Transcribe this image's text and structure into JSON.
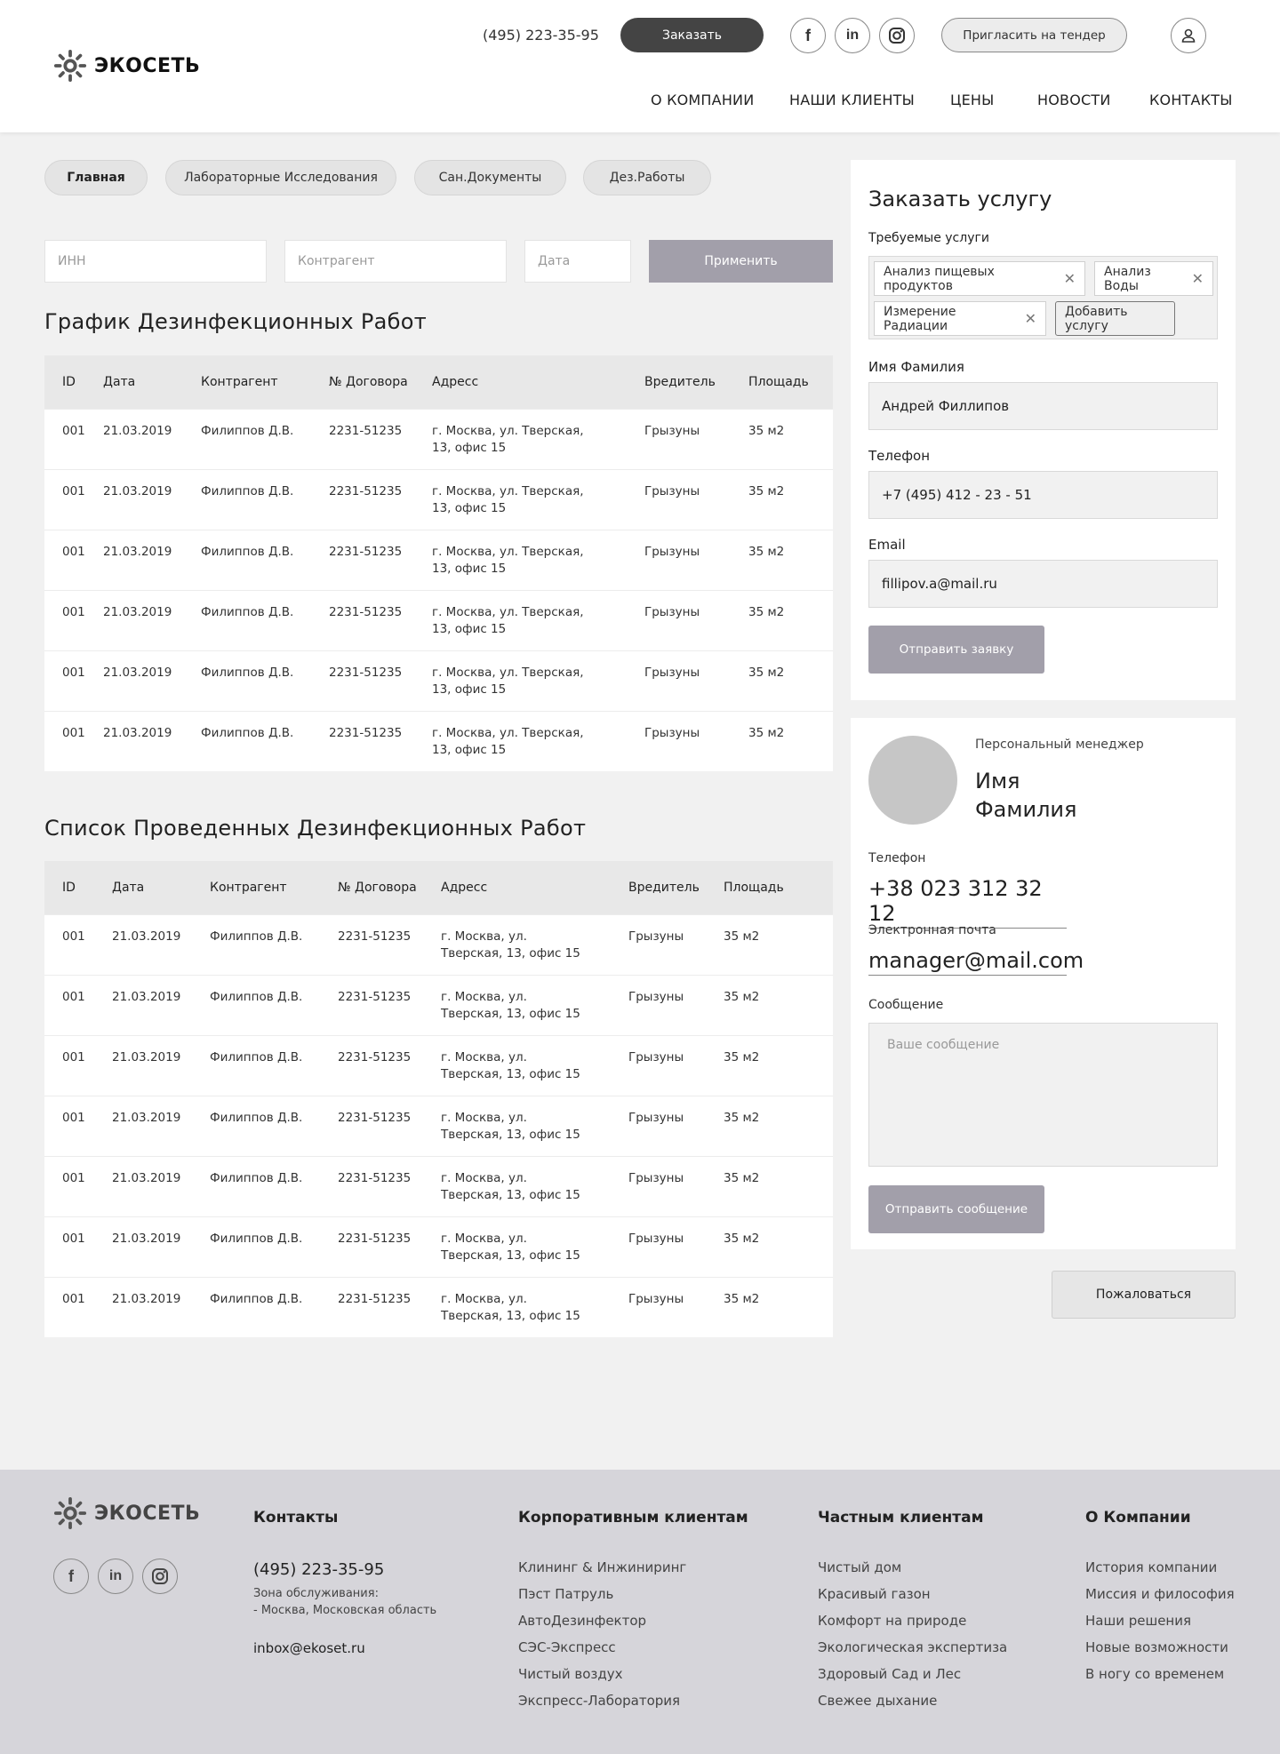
{
  "header": {
    "logo_text": "ЭКОСЕТЬ",
    "phone": "(495) 223-35-95",
    "order_button": "Заказать",
    "invite_button": "Пригласить на тендер",
    "social": [
      "facebook-icon",
      "linkedin-icon",
      "instagram-icon"
    ],
    "nav": [
      "О КОМПАНИИ",
      "НАШИ КЛИЕНТЫ",
      "ЦЕНЫ",
      "НОВОСТИ",
      "КОНТАКТЫ"
    ]
  },
  "tabs": [
    "Главная",
    "Лабораторные Исследования",
    "Сан.Документы",
    "Дез.Работы"
  ],
  "filters": {
    "inn_placeholder": "ИНН",
    "contractor_placeholder": "Контрагент",
    "date_placeholder": "Дата",
    "apply_button": "Применить"
  },
  "schedule": {
    "title": "График Дезинфекционных Работ",
    "columns": [
      "ID",
      "Дата",
      "Контрагент",
      "№ Договора",
      "Адресс",
      "Вредитель",
      "Площадь"
    ],
    "rows": [
      [
        "001",
        "21.03.2019",
        "Филиппов Д.В.",
        "2231-51235",
        "г. Москва, ул. Тверская, 13, офис 15",
        "Грызуны",
        "35 м2"
      ],
      [
        "001",
        "21.03.2019",
        "Филиппов Д.В.",
        "2231-51235",
        "г. Москва, ул. Тверская, 13, офис 15",
        "Грызуны",
        "35 м2"
      ],
      [
        "001",
        "21.03.2019",
        "Филиппов Д.В.",
        "2231-51235",
        "г. Москва, ул. Тверская, 13, офис 15",
        "Грызуны",
        "35 м2"
      ],
      [
        "001",
        "21.03.2019",
        "Филиппов Д.В.",
        "2231-51235",
        "г. Москва, ул. Тверская, 13, офис 15",
        "Грызуны",
        "35 м2"
      ],
      [
        "001",
        "21.03.2019",
        "Филиппов Д.В.",
        "2231-51235",
        "г. Москва, ул. Тверская, 13, офис 15",
        "Грызуны",
        "35 м2"
      ],
      [
        "001",
        "21.03.2019",
        "Филиппов Д.В.",
        "2231-51235",
        "г. Москва, ул. Тверская, 13, офис 15",
        "Грызуны",
        "35 м2"
      ]
    ]
  },
  "completed": {
    "title": "Список Проведенных Дезинфекционных Работ",
    "columns": [
      "ID",
      "Дата",
      "Контрагент",
      "№ Договора",
      "Адресс",
      "Вредитель",
      "Площадь"
    ],
    "rows": [
      [
        "001",
        "21.03.2019",
        "Филиппов Д.В.",
        "2231-51235",
        "г. Москва, ул. Тверская, 13, офис 15",
        "Грызуны",
        "35 м2"
      ],
      [
        "001",
        "21.03.2019",
        "Филиппов Д.В.",
        "2231-51235",
        "г. Москва, ул. Тверская, 13, офис 15",
        "Грызуны",
        "35 м2"
      ],
      [
        "001",
        "21.03.2019",
        "Филиппов Д.В.",
        "2231-51235",
        "г. Москва, ул. Тверская, 13, офис 15",
        "Грызуны",
        "35 м2"
      ],
      [
        "001",
        "21.03.2019",
        "Филиппов Д.В.",
        "2231-51235",
        "г. Москва, ул. Тверская, 13, офис 15",
        "Грызуны",
        "35 м2"
      ],
      [
        "001",
        "21.03.2019",
        "Филиппов Д.В.",
        "2231-51235",
        "г. Москва, ул. Тверская, 13, офис 15",
        "Грызуны",
        "35 м2"
      ],
      [
        "001",
        "21.03.2019",
        "Филиппов Д.В.",
        "2231-51235",
        "г. Москва, ул. Тверская, 13, офис 15",
        "Грызуны",
        "35 м2"
      ],
      [
        "001",
        "21.03.2019",
        "Филиппов Д.В.",
        "2231-51235",
        "г. Москва, ул. Тверская, 13, офис 15",
        "Грызуны",
        "35 м2"
      ]
    ]
  },
  "order_form": {
    "title": "Заказать услугу",
    "services_label": "Требуемые услуги",
    "services": [
      "Анализ пищевых продуктов",
      "Анализ Воды",
      "Измерение Радиации"
    ],
    "add_service": "Добавить услугу",
    "name_label": "Имя Фамилия",
    "name_value": "Андрей Филлипов",
    "phone_label": "Телефон",
    "phone_value": "+7 (495) 412 - 23 - 51",
    "email_label": "Email",
    "email_value": "fillipov.a@mail.ru",
    "submit": "Отправить заявку"
  },
  "manager": {
    "role": "Персональный менеджер",
    "first_name": "Имя",
    "last_name": "Фамилия",
    "phone_label": "Телефон",
    "phone": "+38 023 312 32 12",
    "email_label": "Электронная почта",
    "email": "manager@mail.com",
    "message_label": "Сообщение",
    "message_placeholder": "Ваше сообщение",
    "send_button": "Отправить сообщение"
  },
  "complain_button": "Пожаловаться",
  "footer": {
    "logo_text": "ЭКОСЕТЬ",
    "contacts_title": "Контакты",
    "phone": "(495) 223-35-95",
    "zone_line1": "Зона обслуживания:",
    "zone_line2": "- Москва, Московская область",
    "email": "inbox@ekoset.ru",
    "corporate_title": "Корпоративным клиентам",
    "corporate": [
      "Клининг & Инжиниринг",
      "Пэст Патруль",
      "АвтоДезинфектор",
      "СЭС-Экспресс",
      "Чистый воздух",
      "Экспресс-Лаборатория"
    ],
    "private_title": "Частным клиентам",
    "private": [
      "Чистый дом",
      "Красивый газон",
      "Комфорт на природе",
      "Экологическая экспертиза",
      "Здоровый Сад и Лес",
      "Свежее дыхание"
    ],
    "about_title": "О Компании",
    "about": [
      "История компании",
      "Миссия и философия",
      "Наши решения",
      "Новые возможности",
      "В ногу со временем"
    ]
  }
}
